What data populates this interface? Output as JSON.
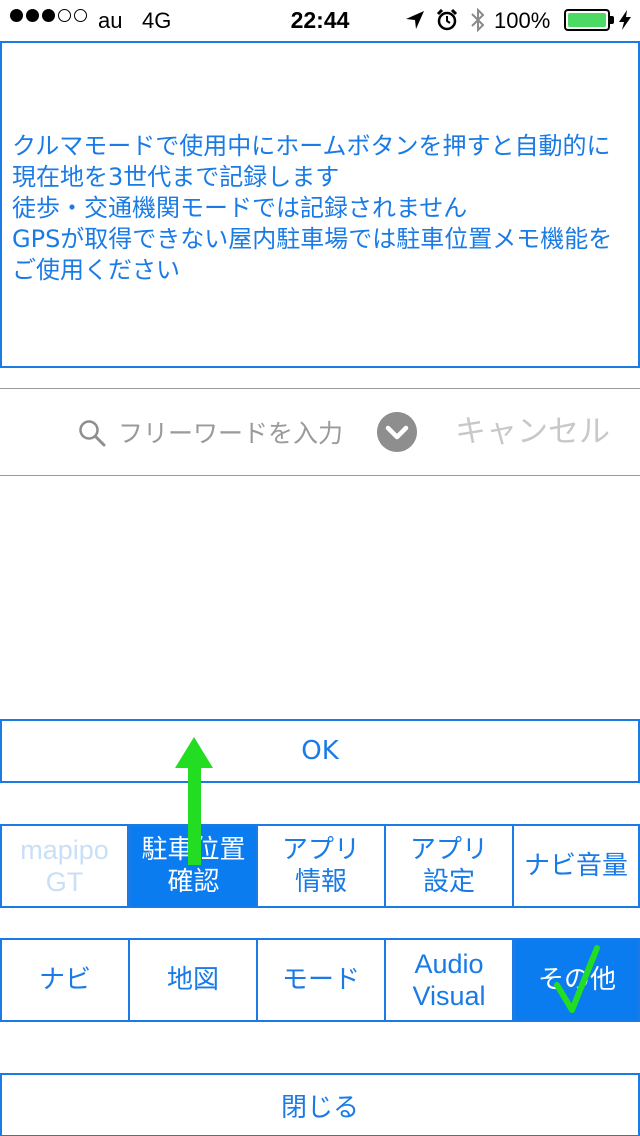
{
  "status_bar": {
    "carrier": "au",
    "network": "4G",
    "time": "22:44",
    "battery_pct": "100%",
    "battery_level": 1.0,
    "signal_bars_on": 3,
    "signal_bars_total": 5,
    "icons": [
      "location-arrow-icon",
      "alarm-clock-icon",
      "bluetooth-icon",
      "battery-icon",
      "charging-bolt-icon"
    ]
  },
  "info": {
    "text": "クルマモードで使用中にホームボタンを押すと自動的に現在地を3世代まで記録します\n徒歩・交通機関モードでは記録されません\nGPSが取得できない屋内駐車場では駐車位置メモ機能をご使用ください"
  },
  "search": {
    "placeholder": "フリーワードを入力",
    "cancel_label": "キャンセル"
  },
  "ok_label": "OK",
  "tabs_row1": [
    {
      "label": "mapipo\nGT",
      "state": "disabled"
    },
    {
      "label": "駐車位置\n確認",
      "state": "selected"
    },
    {
      "label": "アプリ\n情報",
      "state": "normal"
    },
    {
      "label": "アプリ\n設定",
      "state": "normal"
    },
    {
      "label": "ナビ音量",
      "state": "normal"
    }
  ],
  "tabs_row2": [
    {
      "label": "ナビ",
      "state": "normal"
    },
    {
      "label": "地図",
      "state": "normal"
    },
    {
      "label": "モード",
      "state": "normal"
    },
    {
      "label": "Audio\nVisual",
      "state": "normal"
    },
    {
      "label": "その他",
      "state": "selected"
    }
  ],
  "close_label": "閉じる",
  "colors": {
    "accent": "#1a7be6",
    "selected_bg": "#0b7cf0",
    "annotation_green": "#22dd22",
    "battery_green": "#4cd964"
  }
}
